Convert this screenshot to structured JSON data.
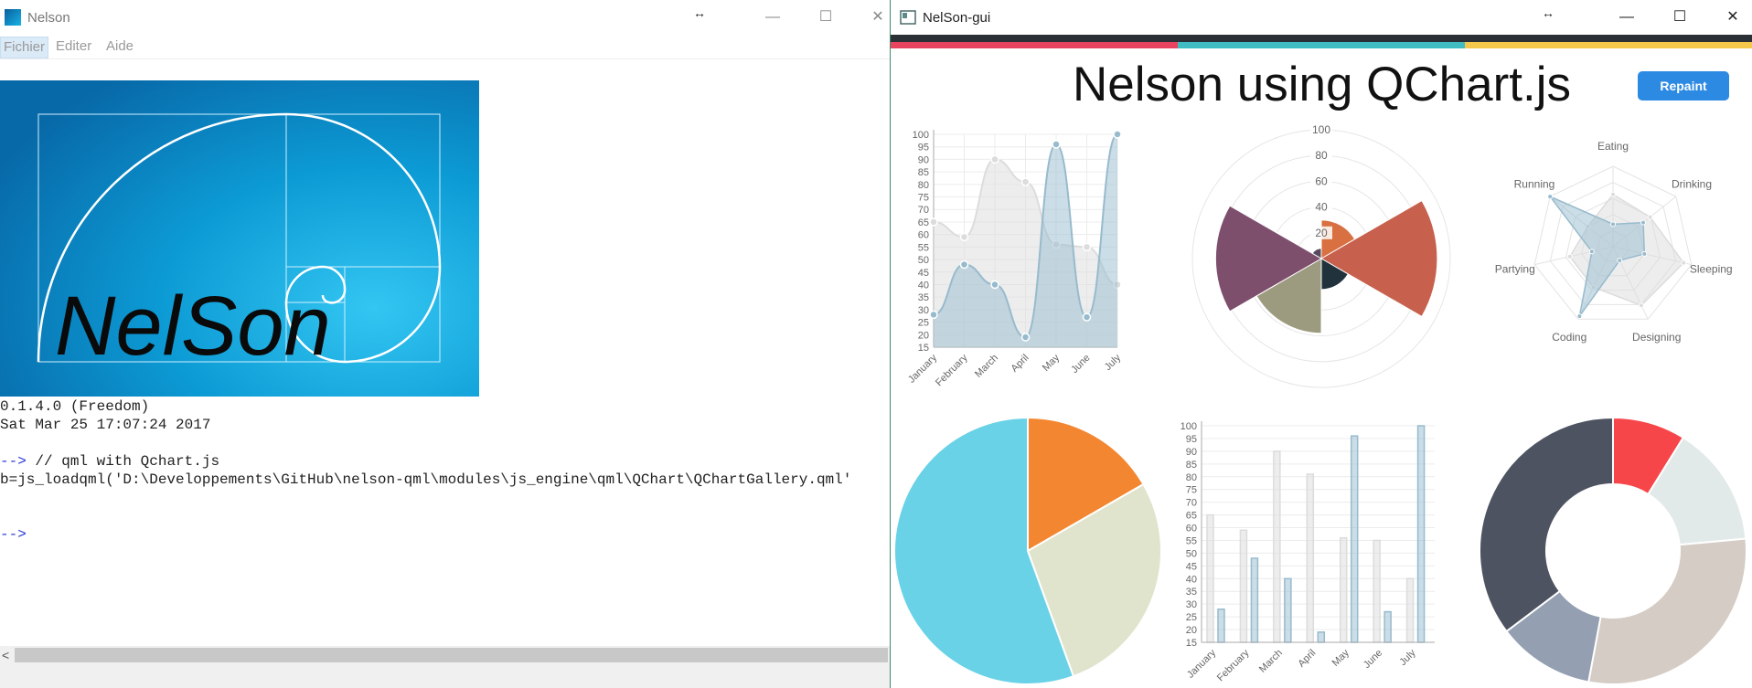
{
  "left_window": {
    "title": "Nelson",
    "menu": [
      "Fichier",
      "Editer",
      "Aide"
    ],
    "logo_text": "NelSon",
    "console_lines": [
      {
        "prompt": "",
        "text": "0.1.4.0 (Freedom)"
      },
      {
        "prompt": "",
        "text": "Sat Mar 25 17:07:24 2017"
      },
      {
        "prompt": "",
        "text": ""
      },
      {
        "prompt": "-->",
        "text": " // qml with Qchart.js"
      },
      {
        "prompt": "",
        "text": "b=js_loadqml('D:\\Developpements\\GitHub\\nelson-qml\\modules\\js_engine\\qml\\QChart\\QChartGallery.qml'"
      },
      {
        "prompt": "",
        "text": ""
      },
      {
        "prompt": "",
        "text": ""
      },
      {
        "prompt": "-->",
        "text": ""
      }
    ],
    "scroll_left_arrow": "<"
  },
  "right_window": {
    "title": "NelSon-gui",
    "heading": "Nelson using QChart.js",
    "repaint_label": "Repaint",
    "stripe_colors": [
      "#e8445f",
      "#3fbdc2",
      "#f5c84c"
    ],
    "window_controls": [
      "—",
      "☐",
      "✕"
    ]
  },
  "chart_data": [
    {
      "type": "line",
      "categories": [
        "January",
        "February",
        "March",
        "April",
        "May",
        "June",
        "July"
      ],
      "series": [
        {
          "values": [
            65,
            59,
            90,
            81,
            56,
            55,
            40
          ],
          "color": "#dcdcdc"
        },
        {
          "values": [
            28,
            48,
            40,
            19,
            96,
            27,
            100
          ],
          "color": "#97bbcd"
        }
      ],
      "ylim": [
        15,
        100
      ],
      "yticks": [
        15,
        20,
        25,
        30,
        35,
        40,
        45,
        50,
        55,
        60,
        65,
        70,
        75,
        80,
        85,
        90,
        95,
        100
      ]
    },
    {
      "type": "polar-area",
      "values": [
        30,
        90,
        24,
        58,
        82,
        8
      ],
      "colors": [
        "#d97041",
        "#c7604c",
        "#21323d",
        "#9d9b7f",
        "#7d4f6d",
        "#584a5e"
      ],
      "rticks": [
        20,
        40,
        60,
        80,
        100
      ],
      "rmax": 100
    },
    {
      "type": "radar",
      "labels": [
        "Eating",
        "Drinking",
        "Sleeping",
        "Designing",
        "Coding",
        "Partying",
        "Running"
      ],
      "series": [
        {
          "values": [
            65,
            59,
            90,
            81,
            56,
            55,
            40
          ],
          "color": "#dcdcdc"
        },
        {
          "values": [
            28,
            48,
            40,
            19,
            96,
            27,
            100
          ],
          "color": "#97bbcd"
        }
      ],
      "rmax": 100
    },
    {
      "type": "pie",
      "values": [
        30,
        50,
        100
      ],
      "colors": [
        "#f38630",
        "#e0e4cc",
        "#69d2e7"
      ]
    },
    {
      "type": "bar",
      "categories": [
        "January",
        "February",
        "March",
        "April",
        "May",
        "June",
        "July"
      ],
      "series": [
        {
          "values": [
            65,
            59,
            90,
            81,
            56,
            55,
            40
          ],
          "color": "#dcdcdc"
        },
        {
          "values": [
            28,
            48,
            40,
            19,
            96,
            27,
            100
          ],
          "color": "#97bbcd"
        }
      ],
      "ylim": [
        15,
        100
      ],
      "yticks": [
        15,
        20,
        25,
        30,
        35,
        40,
        45,
        50,
        55,
        60,
        65,
        70,
        75,
        80,
        85,
        90,
        95,
        100
      ]
    },
    {
      "type": "doughnut",
      "values": [
        30,
        50,
        100,
        40,
        120
      ],
      "colors": [
        "#f7464a",
        "#e2eae9",
        "#d4ccc5",
        "#949fb1",
        "#4d5360"
      ]
    }
  ]
}
